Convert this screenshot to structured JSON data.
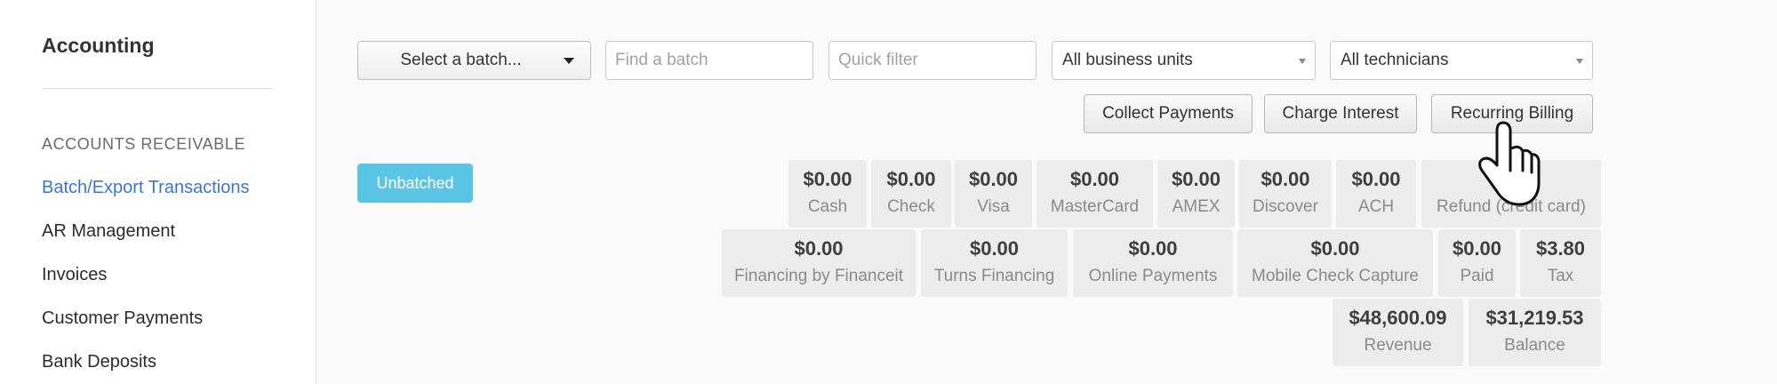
{
  "sidebar": {
    "title": "Accounting",
    "section_label": "ACCOUNTS RECEIVABLE",
    "items": [
      {
        "label": "Batch/Export Transactions"
      },
      {
        "label": "AR Management"
      },
      {
        "label": "Invoices"
      },
      {
        "label": "Customer Payments"
      },
      {
        "label": "Bank Deposits"
      }
    ],
    "active_color": "#3a74d6"
  },
  "toolbar": {
    "batch_select": "Select a batch...",
    "find_placeholder": "Find a batch",
    "quick_placeholder": "Quick filter",
    "business_units": "All business units",
    "technicians": "All technicians"
  },
  "actions": {
    "collect": "Collect Payments",
    "charge": "Charge Interest",
    "recurring": "Recurring Billing"
  },
  "unbatched": {
    "label": "Unbatched",
    "color": "#5bc5e6"
  },
  "totals": [
    {
      "amount": "$0.00",
      "label": "Cash"
    },
    {
      "amount": "$0.00",
      "label": "Check"
    },
    {
      "amount": "$0.00",
      "label": "Visa"
    },
    {
      "amount": "$0.00",
      "label": "MasterCard"
    },
    {
      "amount": "$0.00",
      "label": "AMEX"
    },
    {
      "amount": "$0.00",
      "label": "Discover"
    },
    {
      "amount": "$0.00",
      "label": "ACH"
    },
    {
      "amount": "",
      "label": "Refund (credit card)"
    },
    {
      "amount": "$0.00",
      "label": "Financing by Financeit"
    },
    {
      "amount": "$0.00",
      "label": "Turns Financing"
    },
    {
      "amount": "$0.00",
      "label": "Online Payments"
    },
    {
      "amount": "$0.00",
      "label": "Mobile Check Capture"
    },
    {
      "amount": "$0.00",
      "label": "Paid"
    },
    {
      "amount": "$3.80",
      "label": "Tax"
    },
    {
      "amount": "$48,600.09",
      "label": "Revenue"
    },
    {
      "amount": "$31,219.53",
      "label": "Balance"
    }
  ],
  "pointer_icon": "hand-pointer-icon"
}
